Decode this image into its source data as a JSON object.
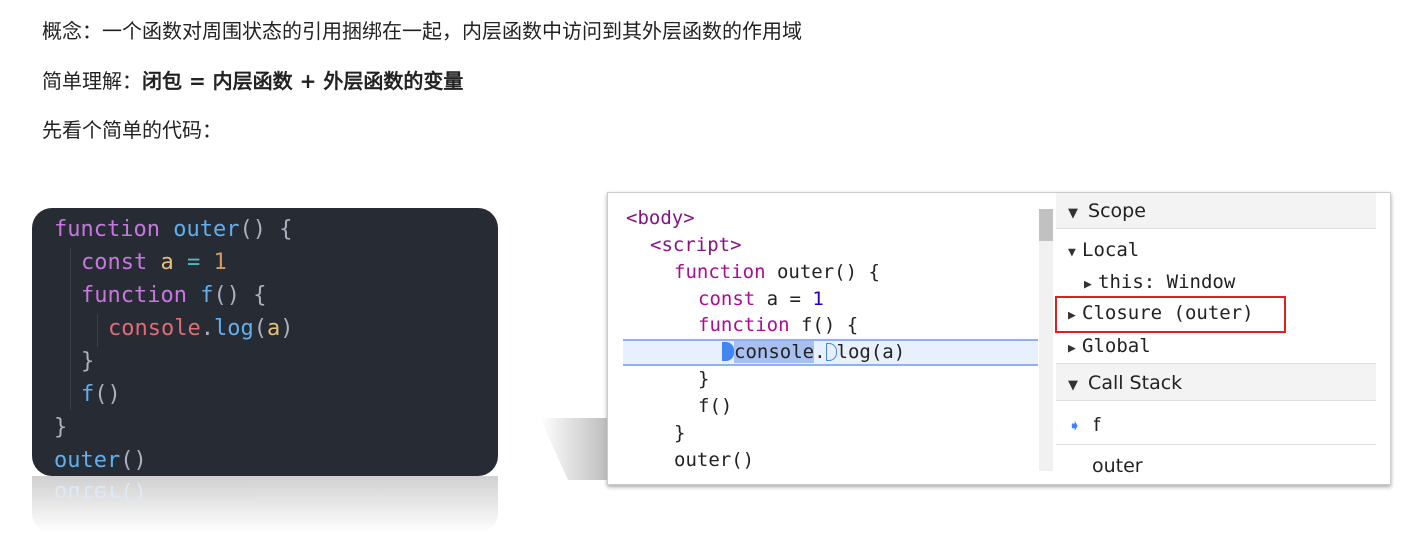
{
  "text": {
    "line1": "概念：一个函数对周围状态的引用捆绑在一起，内层函数中访问到其外层函数的作用域",
    "line2_prefix": "简单理解：",
    "line2_bold": "闭包 =  内层函数 + 外层函数的变量",
    "line3": "先看个简单的代码："
  },
  "left_code": {
    "l1": [
      "function",
      "outer",
      "()",
      "{"
    ],
    "l2": [
      "const",
      "a",
      "=",
      "1"
    ],
    "l3": [
      "function",
      "f",
      "()",
      "{"
    ],
    "l4": [
      "console",
      ".",
      "log",
      "(",
      "a",
      ")"
    ],
    "l5": "}",
    "l6": [
      "f",
      "()"
    ],
    "l7": "}",
    "l8": [
      "outer",
      "()"
    ],
    "reflection": "outer()"
  },
  "devtools": {
    "code": {
      "body": "<body>",
      "script": "<script>",
      "outer_kw": "function",
      "outer_sig": " outer() {",
      "const_kw": "const",
      "const_rest": " a = ",
      "const_val": "1",
      "f_kw": "function",
      "f_sig": " f() {",
      "console": "console",
      "dot": ".",
      "log": "log(a)",
      "close1": "}",
      "fcall": "f()",
      "close2": "}",
      "outercall": "outer()"
    },
    "scope": {
      "header": "Scope",
      "local": "Local",
      "this": "this: Window",
      "closure": "Closure (outer)",
      "global": "Global"
    },
    "callstack": {
      "header": "Call Stack",
      "frames": [
        "f",
        "outer"
      ]
    },
    "colors": {
      "highlight_box": "#e02020",
      "current_frame_arrow": "#4285f4"
    }
  }
}
